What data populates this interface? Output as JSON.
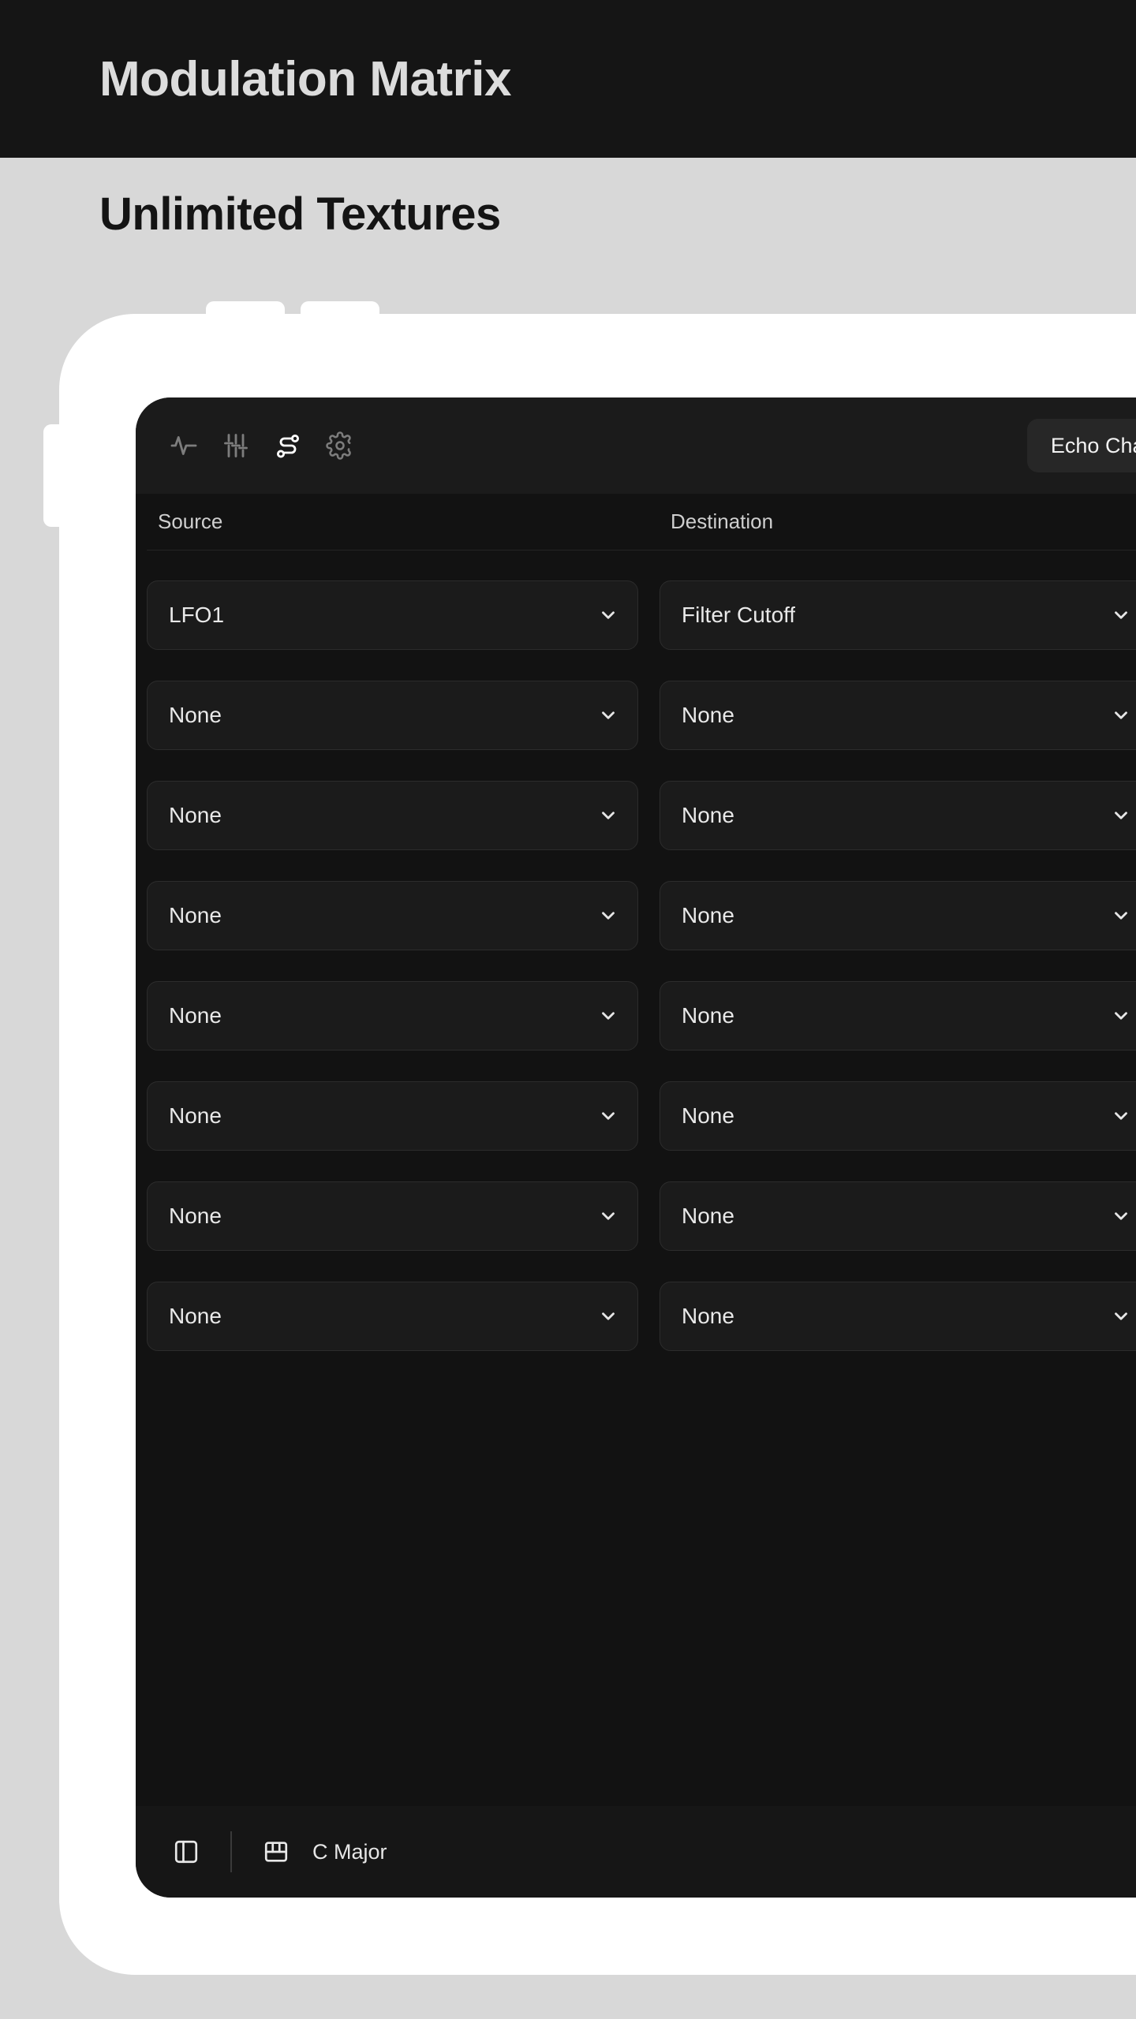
{
  "banner": {
    "title": "Modulation Matrix"
  },
  "section": {
    "title": "Unlimited Textures"
  },
  "app": {
    "toolbar": {
      "icons": [
        {
          "name": "activity-icon",
          "label": "Waveform",
          "active": false
        },
        {
          "name": "sliders-icon",
          "label": "Mixer",
          "active": false
        },
        {
          "name": "route-icon",
          "label": "Routing",
          "active": true
        },
        {
          "name": "gear-icon",
          "label": "Settings",
          "active": false
        }
      ],
      "preset_chip": "Echo Chamber"
    },
    "matrix": {
      "columns": [
        "Source",
        "Destination"
      ],
      "rows": [
        {
          "source": "LFO1",
          "destination": "Filter Cutoff"
        },
        {
          "source": "None",
          "destination": "None"
        },
        {
          "source": "None",
          "destination": "None"
        },
        {
          "source": "None",
          "destination": "None"
        },
        {
          "source": "None",
          "destination": "None"
        },
        {
          "source": "None",
          "destination": "None"
        },
        {
          "source": "None",
          "destination": "None"
        },
        {
          "source": "None",
          "destination": "None"
        }
      ]
    },
    "status_bar": {
      "panel_toggle_icon": "panel-left-icon",
      "key_icon": "piano-keyboard-icon",
      "key_label": "C Major"
    }
  },
  "colors": {
    "banner_bg": "#151515",
    "page_bg": "#d8d8d8",
    "screen_bg": "#121212",
    "toolbar_bg": "#1b1b1b",
    "accent_active": "#ffffff"
  }
}
